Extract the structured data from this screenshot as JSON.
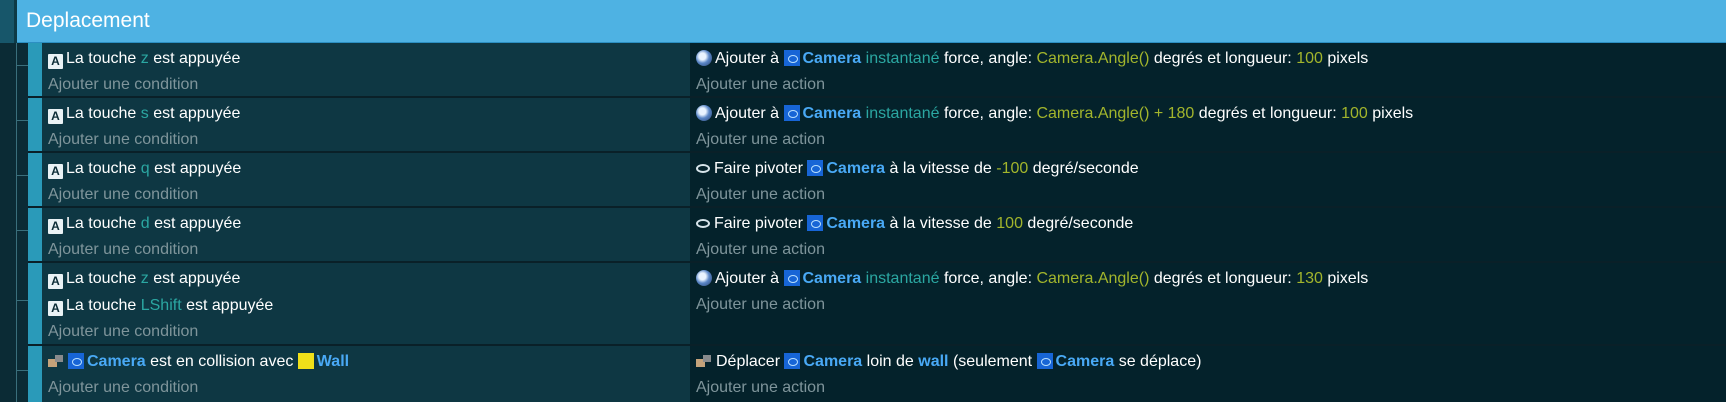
{
  "group": {
    "title": "Deplacement"
  },
  "add_condition_label": "Ajouter une condition",
  "add_action_label": "Ajouter une action",
  "events": [
    {
      "conditions": [
        {
          "pre": "La touche",
          "key": "z",
          "post": "est appuyée"
        }
      ],
      "action": {
        "pre": "Ajouter à",
        "object": "Camera",
        "mode": "instantané",
        "mid": "force, angle:",
        "expr": "Camera.Angle()",
        "mid2": "degrés et longueur:",
        "value": "100",
        "post": "pixels"
      }
    },
    {
      "conditions": [
        {
          "pre": "La touche",
          "key": "s",
          "post": "est appuyée"
        }
      ],
      "action": {
        "pre": "Ajouter à",
        "object": "Camera",
        "mode": "instantané",
        "mid": "force, angle:",
        "expr": "Camera.Angle() + 180",
        "mid2": "degrés et longueur:",
        "value": "100",
        "post": "pixels"
      }
    },
    {
      "conditions": [
        {
          "pre": "La touche",
          "key": "q",
          "post": "est appuyée"
        }
      ],
      "action": {
        "pre": "Faire pivoter",
        "object": "Camera",
        "mid": "à la vitesse de",
        "value": "-100",
        "post": "degré/seconde"
      }
    },
    {
      "conditions": [
        {
          "pre": "La touche",
          "key": "d",
          "post": "est appuyée"
        }
      ],
      "action": {
        "pre": "Faire pivoter",
        "object": "Camera",
        "mid": "à la vitesse de",
        "value": "100",
        "post": "degré/seconde"
      }
    },
    {
      "conditions": [
        {
          "pre": "La touche",
          "key": "z",
          "post": "est appuyée"
        },
        {
          "pre": "La touche",
          "key": "LShift",
          "post": "est appuyée"
        }
      ],
      "action": {
        "pre": "Ajouter à",
        "object": "Camera",
        "mode": "instantané",
        "mid": "force, angle:",
        "expr": "Camera.Angle()",
        "mid2": "degrés et longueur:",
        "value": "130",
        "post": "pixels"
      }
    },
    {
      "conditions": [
        {
          "object": "Camera",
          "mid": "est en collision avec",
          "target": "Wall"
        }
      ],
      "action": {
        "pre": "Déplacer",
        "object": "Camera",
        "mid": "loin de",
        "target": "wall",
        "mid2": "(seulement",
        "object2": "Camera",
        "post": "se déplace)"
      }
    }
  ],
  "colors": {
    "header": "#4eb2e3",
    "accent": "#2a9ab9",
    "teal_param": "#2ba7a2",
    "lime_param": "#a2b52c",
    "object_blue": "#49a9f5"
  },
  "icons": {
    "key": "keyboard-key-icon",
    "object": "sprite-object-icon",
    "wall": "wall-object-icon",
    "force": "force-icon",
    "rotate": "rotate-icon",
    "collision": "collision-icon"
  }
}
